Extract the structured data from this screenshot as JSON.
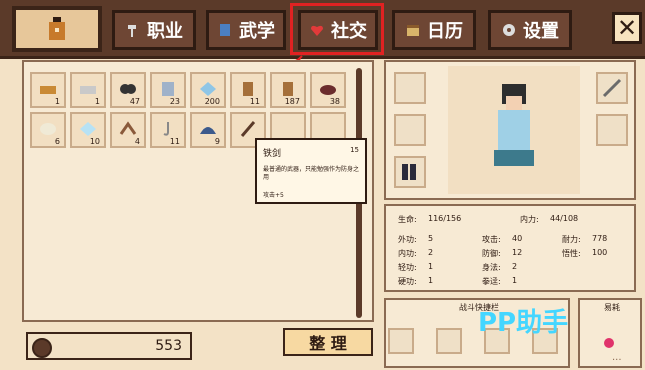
{
  "tabs": [
    {
      "label": "职业",
      "icon": "hammer-icon"
    },
    {
      "label": "武学",
      "icon": "book-icon"
    },
    {
      "label": "社交",
      "icon": "heart-icon"
    },
    {
      "label": "日历",
      "icon": "calendar-icon"
    },
    {
      "label": "设置",
      "icon": "gear-icon"
    }
  ],
  "close_label": "✕",
  "inventory": {
    "slots": [
      {
        "count": "1",
        "icon": "bread-icon"
      },
      {
        "count": "1",
        "icon": "iron-bar-icon"
      },
      {
        "count": "47",
        "icon": "charcoal-icon"
      },
      {
        "count": "23",
        "icon": "book-icon"
      },
      {
        "count": "200",
        "icon": "crystal-icon"
      },
      {
        "count": "11",
        "icon": "barrel-icon"
      },
      {
        "count": "187",
        "icon": "barrel-icon"
      },
      {
        "count": "38",
        "icon": "bowl-icon"
      },
      {
        "count": "6",
        "icon": "pearl-icon"
      },
      {
        "count": "10",
        "icon": "ice-crystal-icon"
      },
      {
        "count": "4",
        "icon": "boomerang-icon"
      },
      {
        "count": "11",
        "icon": "hook-icon"
      },
      {
        "count": "9",
        "icon": "helmet-icon"
      },
      {
        "count": "",
        "icon": "sword-icon"
      }
    ]
  },
  "tooltip": {
    "name": "铁剑",
    "level": "15",
    "desc": "最普通的武器，只能勉强作为防身之用",
    "bonus": "攻击+5"
  },
  "money": "553",
  "sort_label": "整 理",
  "stats": {
    "life_label": "生命:",
    "life_value": "116/156",
    "neili_label": "内力:",
    "neili_value": "44/108",
    "waigong_label": "外功:",
    "waigong_value": "5",
    "attack_label": "攻击:",
    "attack_value": "40",
    "stamina_label": "耐力:",
    "stamina_value": "778",
    "neigong_label": "内功:",
    "neigong_value": "2",
    "defense_label": "防御:",
    "defense_value": "12",
    "wuxing_label": "悟性:",
    "wuxing_value": "100",
    "qinggong_label": "轻功:",
    "qinggong_value": "1",
    "shenfa_label": "身法:",
    "shenfa_value": "2",
    "yinggong_label": "硬功:",
    "yinggong_value": "1",
    "shoushi_label": "拳迳:",
    "shoushi_value": "1"
  },
  "battle_title": "战斗快捷栏",
  "consume_title": "易耗",
  "watermark": "PP助手",
  "colors": {
    "highlight": "#e02222",
    "panel": "#f7ead4",
    "frame": "#5b3a29"
  }
}
